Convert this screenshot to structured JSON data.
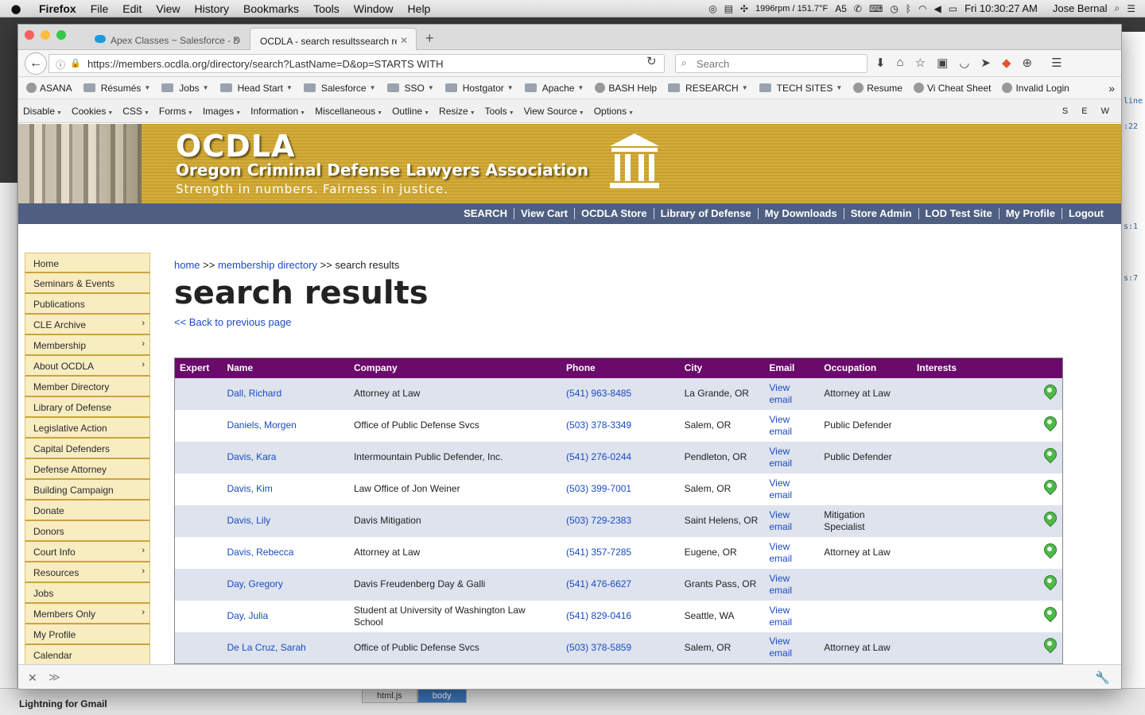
{
  "menubar": {
    "app": "Firefox",
    "items": [
      "File",
      "Edit",
      "View",
      "History",
      "Bookmarks",
      "Tools",
      "Window",
      "Help"
    ],
    "status": "1996rpm / 151.7°F",
    "badge": "5",
    "clock": "Fri 10:30:27 AM",
    "user": "Jose Bernal"
  },
  "tabs": [
    {
      "title": "Apex Classes ~ Salesforce - D",
      "color": "#1a9be0"
    },
    {
      "title": "OCDLA - search resultssearch res"
    }
  ],
  "url": "https://members.ocdla.org/directory/search?LastName=D&op=STARTS WITH",
  "search_placeholder": "Search",
  "bookmarks": [
    {
      "label": "ASANA",
      "type": "site"
    },
    {
      "label": "Résumés",
      "type": "folder"
    },
    {
      "label": "Jobs",
      "type": "folder"
    },
    {
      "label": "Head Start",
      "type": "folder"
    },
    {
      "label": "Salesforce",
      "type": "folder"
    },
    {
      "label": "SSO",
      "type": "folder"
    },
    {
      "label": "Hostgator",
      "type": "folder"
    },
    {
      "label": "Apache",
      "type": "folder"
    },
    {
      "label": "BASH Help",
      "type": "site"
    },
    {
      "label": "RESEARCH",
      "type": "folder"
    },
    {
      "label": "TECH SITES",
      "type": "folder"
    },
    {
      "label": "Resume",
      "type": "site"
    },
    {
      "label": "Vi Cheat Sheet",
      "type": "site"
    },
    {
      "label": "Invalid Login",
      "type": "site"
    }
  ],
  "devtools": [
    "Disable",
    "Cookies",
    "CSS",
    "Forms",
    "Images",
    "Information",
    "Miscellaneous",
    "Outline",
    "Resize",
    "Tools",
    "View Source",
    "Options"
  ],
  "devtools_right": "S E W",
  "banner": {
    "title": "OCDLA",
    "subtitle": "Oregon Criminal Defense Lawyers Association",
    "tagline": "Strength in numbers. Fairness in justice."
  },
  "topnav": [
    "SEARCH",
    "View Cart",
    "OCDLA Store",
    "Library of Defense",
    "My Downloads",
    "Store Admin",
    "LOD Test Site",
    "My Profile",
    "Logout"
  ],
  "sidebar": [
    {
      "label": "Home",
      "sub": false
    },
    {
      "label": "Seminars & Events",
      "sub": false
    },
    {
      "label": "Publications",
      "sub": false
    },
    {
      "label": "CLE Archive",
      "sub": true
    },
    {
      "label": "Membership",
      "sub": true
    },
    {
      "label": "About OCDLA",
      "sub": true
    },
    {
      "label": "Member Directory",
      "sub": false
    },
    {
      "label": "Library of Defense",
      "sub": false
    },
    {
      "label": "Legislative Action",
      "sub": false
    },
    {
      "label": "Capital Defenders",
      "sub": false
    },
    {
      "label": "Defense Attorney",
      "sub": false
    },
    {
      "label": "Building Campaign",
      "sub": false
    },
    {
      "label": "Donate",
      "sub": false
    },
    {
      "label": "Donors",
      "sub": false
    },
    {
      "label": "Court Info",
      "sub": true
    },
    {
      "label": "Resources",
      "sub": true
    },
    {
      "label": "Jobs",
      "sub": false
    },
    {
      "label": "Members Only",
      "sub": true
    },
    {
      "label": "My Profile",
      "sub": false
    },
    {
      "label": "Calendar",
      "sub": false
    }
  ],
  "breadcrumb": {
    "home": "home",
    "sep": ">>",
    "directory": "membership directory",
    "current": "search results"
  },
  "page_title": "search results",
  "back_link": "<< Back to previous page",
  "table": {
    "headers": [
      "Expert",
      "Name",
      "Company",
      "Phone",
      "City",
      "Email",
      "Occupation",
      "Interests"
    ],
    "email_label": "View email",
    "rows": [
      {
        "name": "Dall, Richard",
        "company": "Attorney at Law",
        "phone": "(541) 963-8485",
        "city": "La Grande, OR",
        "occupation": "Attorney at Law"
      },
      {
        "name": "Daniels, Morgen",
        "company": "Office of Public Defense Svcs",
        "phone": "(503) 378-3349",
        "city": "Salem, OR",
        "occupation": "Public Defender"
      },
      {
        "name": "Davis, Kara",
        "company": "Intermountain Public Defender, Inc.",
        "phone": "(541) 276-0244",
        "city": "Pendleton, OR",
        "occupation": "Public Defender"
      },
      {
        "name": "Davis, Kim",
        "company": "Law Office of Jon Weiner",
        "phone": "(503) 399-7001",
        "city": "Salem, OR",
        "occupation": ""
      },
      {
        "name": "Davis, Lily",
        "company": "Davis Mitigation",
        "phone": "(503) 729-2383",
        "city": "Saint Helens, OR",
        "occupation": "Mitigation Specialist"
      },
      {
        "name": "Davis, Rebecca",
        "company": "Attorney at Law",
        "phone": "(541) 357-7285",
        "city": "Eugene, OR",
        "occupation": "Attorney at Law"
      },
      {
        "name": "Day, Gregory",
        "company": "Davis Freudenberg Day & Galli",
        "phone": "(541) 476-6627",
        "city": "Grants Pass, OR",
        "occupation": ""
      },
      {
        "name": "Day, Julia",
        "company": "Student at University of Washington Law School",
        "phone": "(541) 829-0416",
        "city": "Seattle, WA",
        "occupation": ""
      },
      {
        "name": "De La Cruz, Sarah",
        "company": "Office of Public Defense Svcs",
        "phone": "(503) 378-5859",
        "city": "Salem, OR",
        "occupation": "Attorney at Law"
      }
    ]
  },
  "background": {
    "bottom_label": "Lightning for Gmail",
    "bottom_tabs": [
      "html.js",
      "body"
    ],
    "right_snippets": [
      "line",
      ":22",
      "s:1",
      "s:7"
    ]
  }
}
